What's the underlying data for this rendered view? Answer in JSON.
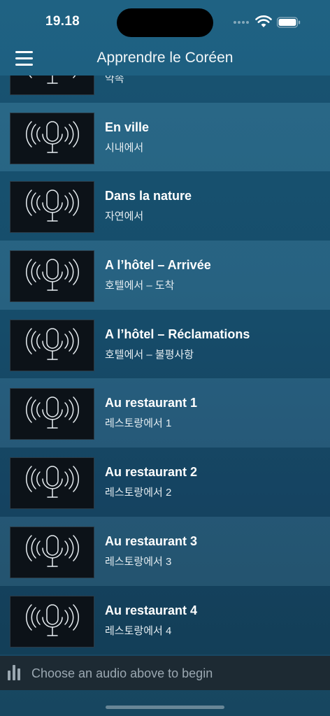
{
  "status": {
    "time": "19.18"
  },
  "nav": {
    "title": "Apprendre le Coréen"
  },
  "lessons": [
    {
      "title": "",
      "subtitle": "약속"
    },
    {
      "title": "En ville",
      "subtitle": "시내에서"
    },
    {
      "title": "Dans la nature",
      "subtitle": "자연에서"
    },
    {
      "title": "A l’hôtel – Arrivée",
      "subtitle": "호텔에서 – 도착"
    },
    {
      "title": "A l’hôtel – Réclamations",
      "subtitle": "호텔에서 – 불평사항"
    },
    {
      "title": "Au restaurant 1",
      "subtitle": "레스토랑에서 1"
    },
    {
      "title": "Au restaurant 2",
      "subtitle": "레스토랑에서 2"
    },
    {
      "title": "Au restaurant 3",
      "subtitle": "레스토랑에서 3"
    },
    {
      "title": "Au restaurant 4",
      "subtitle": "레스토랑에서 4"
    }
  ],
  "player": {
    "message": "Choose an audio above to begin"
  },
  "icons": {
    "menu": "hamburger-menu-icon",
    "lesson": "microphone-broadcast-icon",
    "player": "equalizer-icon"
  }
}
